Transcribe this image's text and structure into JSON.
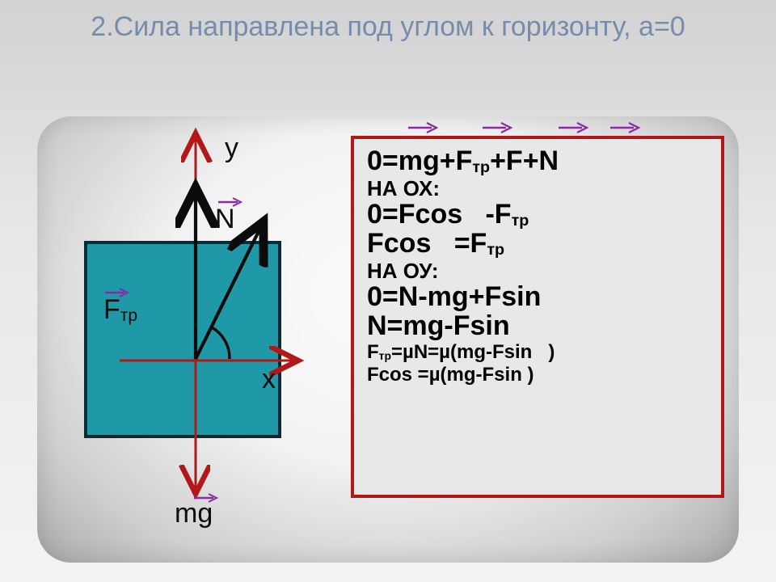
{
  "title": "2.Сила направлена под углом    к горизонту, а=0",
  "diagram": {
    "axis_y": "y",
    "axis_x": "x",
    "N_label": "N",
    "Ftr_label_F": "F",
    "Ftr_label_sub": "тр",
    "mg_label": "mg"
  },
  "equations": {
    "line1": "0=mg+Fтр+F+N",
    "line2": "НА ОХ:",
    "line3": "0=Fcos   -Fтр",
    "line4": "Fcos   =Fтр",
    "line5": "НА ОУ:",
    "line6": "0=N-mg+Fsin",
    "line7": "N=mg-Fsin",
    "line8": "Fтр=µN=µ(mg-Fsin   )",
    "line9": "Fcos   =µ(mg-Fsin   )"
  },
  "colors": {
    "block": "#1f99a8",
    "axis": "#b21818",
    "vec_small": "#8a2aa8",
    "box_border": "#b21818"
  }
}
